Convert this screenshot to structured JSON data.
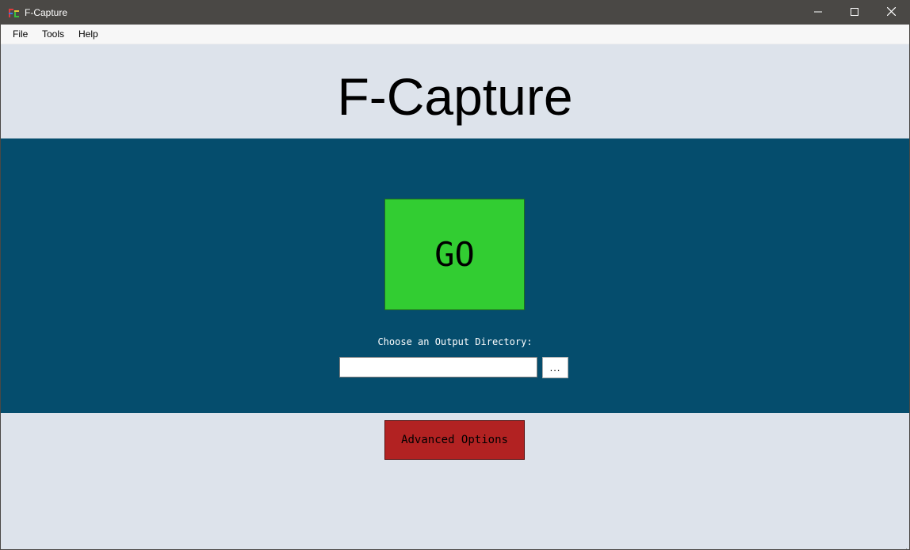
{
  "window": {
    "title": "F-Capture",
    "icons": {
      "app": "app-icon",
      "minimize": "minimize-icon",
      "maximize": "maximize-icon",
      "close": "close-icon"
    }
  },
  "menu": {
    "items": [
      {
        "label": "File"
      },
      {
        "label": "Tools"
      },
      {
        "label": "Help"
      }
    ]
  },
  "header": {
    "title": "F-Capture"
  },
  "main": {
    "go_label": "GO",
    "output_label": "Choose an Output Directory:",
    "output_value": "",
    "browse_label": "..."
  },
  "advanced": {
    "label": "Advanced Options"
  },
  "colors": {
    "titlebar": "#4a4845",
    "background": "#dde3eb",
    "panel": "#054d6d",
    "go": "#32cd32",
    "advanced": "#b22222"
  }
}
